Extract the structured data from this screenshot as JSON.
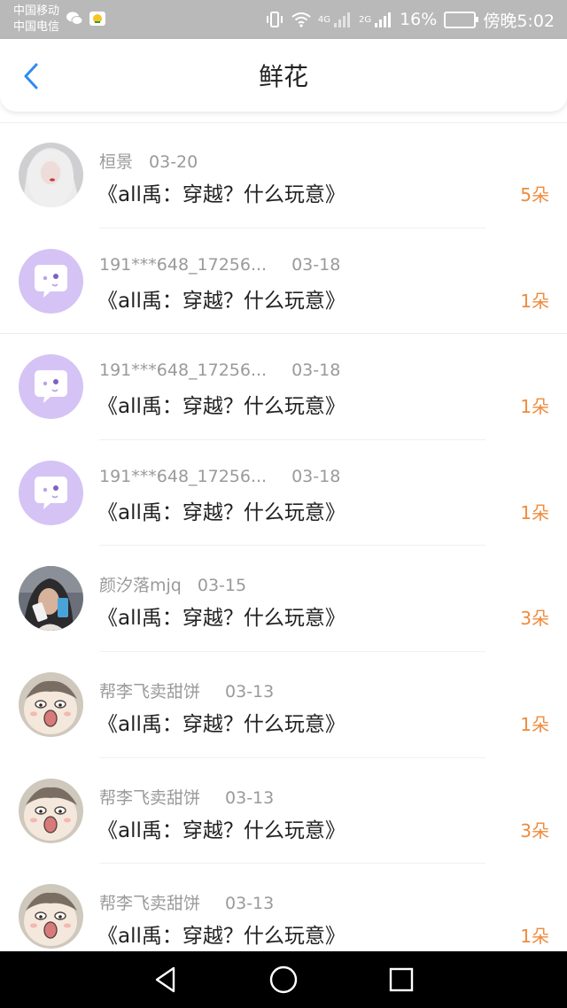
{
  "status_bar": {
    "carrier_1": "中国移动",
    "carrier_2": "中国电信",
    "network_1": "4G",
    "network_2": "2G",
    "battery": "16%",
    "time": "傍晚5:02"
  },
  "header": {
    "title": "鲜花",
    "back_icon": "chevron-left-icon"
  },
  "colors": {
    "accent_blue": "#2e8cf0",
    "count_orange": "#ef8b3c",
    "status_bar_bg": "#b9b9b9"
  },
  "items": [
    {
      "user": "桓景",
      "date": "03-20",
      "work": "《all禹：穿越？什么玩意》",
      "count": "5朵",
      "avatar": "photo-white-hair"
    },
    {
      "user": "191***648_17256...",
      "date": "03-18",
      "work": "《all禹：穿越？什么玩意》",
      "count": "1朵",
      "avatar": "default-chat-bubble"
    },
    {
      "user": "191***648_17256...",
      "date": "03-18",
      "work": "《all禹：穿越？什么玩意》",
      "count": "1朵",
      "avatar": "default-chat-bubble"
    },
    {
      "user": "191***648_17256...",
      "date": "03-18",
      "work": "《all禹：穿越？什么玩意》",
      "count": "1朵",
      "avatar": "default-chat-bubble"
    },
    {
      "user": "颜汐落mjq",
      "date": "03-15",
      "work": "《all禹：穿越？什么玩意》",
      "count": "3朵",
      "avatar": "photo-selfie"
    },
    {
      "user": "帮李飞卖甜饼",
      "date": "03-13",
      "work": "《all禹：穿越？什么玩意》",
      "count": "1朵",
      "avatar": "cartoon-face"
    },
    {
      "user": "帮李飞卖甜饼",
      "date": "03-13",
      "work": "《all禹：穿越？什么玩意》",
      "count": "3朵",
      "avatar": "cartoon-face"
    },
    {
      "user": "帮李飞卖甜饼",
      "date": "03-13",
      "work": "《all禹：穿越？什么玩意》",
      "count": "1朵",
      "avatar": "cartoon-face"
    }
  ],
  "system_nav": {
    "back": "triangle-back-icon",
    "home": "circle-home-icon",
    "recents": "square-recents-icon"
  }
}
